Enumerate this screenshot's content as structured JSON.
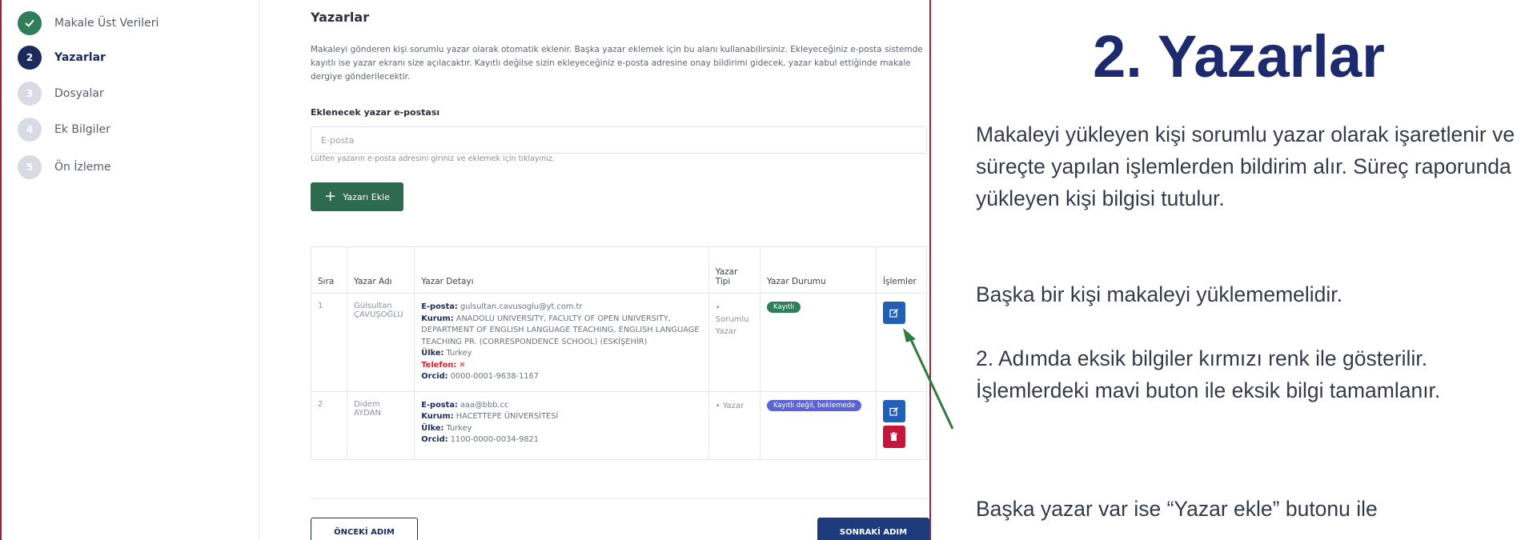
{
  "stepper": {
    "steps": [
      {
        "number": "✓",
        "label": "Makale Üst Verileri",
        "state": "done"
      },
      {
        "number": "2",
        "label": "Yazarlar",
        "state": "active"
      },
      {
        "number": "3",
        "label": "Dosyalar",
        "state": "pending"
      },
      {
        "number": "4",
        "label": "Ek Bilgiler",
        "state": "pending"
      },
      {
        "number": "5",
        "label": "Ön İzleme",
        "state": "pending"
      }
    ]
  },
  "main": {
    "title": "Yazarlar",
    "description": "Makaleyi gönderen kişi sorumlu yazar olarak otomatik eklenir. Başka yazar eklemek için bu alanı kullanabilirsiniz. Ekleyeceğiniz e-posta sistemde kayıtlı ise yazar ekranı size açılacaktır. Kayıtlı değilse sizin ekleyeceğiniz e-posta adresine onay bildirimi gidecek, yazar kabul ettiğinde makale dergiye gönderilecektir.",
    "field_label": "Eklenecek yazar e-postası",
    "email_value": "",
    "email_placeholder": "E-posta",
    "field_hint": "Lütfen yazarın e-posta adresini giriniz ve eklemek için tıklayınız.",
    "add_button": "Yazarı Ekle",
    "table": {
      "headers": [
        "Sıra",
        "Yazar Adı",
        "Yazar Detayı",
        "Yazar Tipi",
        "Yazar Durumu",
        "İşlemler"
      ],
      "rows": [
        {
          "order": "1",
          "name": "Gülsultan ÇAVUŞOĞLU",
          "email_label": "E-posta:",
          "email": "gulsultan.cavusoglu@yt.com.tr",
          "institution_label": "Kurum:",
          "institution": "ANADOLU UNIVERSITY, FACULTY OF OPEN UNIVERSITY, DEPARTMENT OF ENGLISH LANGUAGE TEACHING, ENGLISH LANGUAGE TEACHING PR. (CORRESPONDENCE SCHOOL) (ESKİŞEHİR)",
          "country_label": "Ülke:",
          "country": "Turkey",
          "phone_label": "Telefon:",
          "phone": "✕",
          "orcid_label": "Orcid:",
          "orcid": "0000-0001-9638-1167",
          "type": "• Sorumlu Yazar",
          "status": "Kayıtlı",
          "status_color": "#2e7d5b"
        },
        {
          "order": "2",
          "name": "Didem AYDAN",
          "email_label": "E-posta:",
          "email": "aaa@bbb.cc",
          "institution_label": "Kurum:",
          "institution": "HACETTEPE ÜNİVERSİTESİ",
          "country_label": "Ülke:",
          "country": "Turkey",
          "orcid_label": "Orcid:",
          "orcid": "1100-0000-0034-9821",
          "type": "• Yazar",
          "status": "Kayıtlı değil, beklemede",
          "status_color": "#5a63d8"
        }
      ]
    },
    "prev_button": "ÖNCEKİ ADIM",
    "next_button": "SONRAKİ ADIM"
  },
  "slide": {
    "title": "2. Yazarlar",
    "paragraph1": "Makaleyi yükleyen kişi sorumlu yazar olarak işaretlenir ve süreçte yapılan işlemlerden bildirim alır. Süreç raporunda yükleyen kişi bilgisi tutulur.",
    "paragraph1b": "Başka bir kişi makaleyi yüklememelidir.",
    "paragraph2": "2. Adımda eksik bilgiler kırmızı renk ile gösterilir. İşlemlerdeki mavi buton ile eksik bilgi tamamlanır.",
    "paragraph3": "Başka yazar var ise “Yazar ekle” butonu ile"
  },
  "colors": {
    "frame_border": "#9b2335",
    "primary_navy": "#1d2a5c",
    "success_green": "#2e7d5b",
    "edit_blue": "#2260b5",
    "delete_red": "#c3163a",
    "arrow_green": "#2f7a3c"
  },
  "icons": {
    "edit": "edit-icon",
    "delete": "trash-icon",
    "check": "check-icon",
    "plus": "plus-icon"
  }
}
